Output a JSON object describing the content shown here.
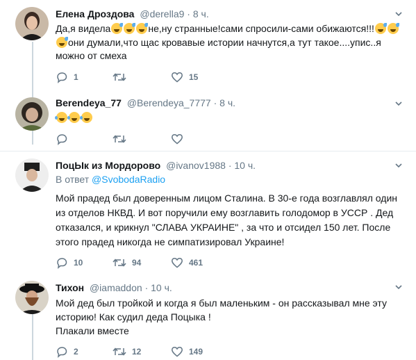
{
  "tweets": [
    {
      "name": "Елена Дроздова",
      "handle": "@derella9",
      "dot": "·",
      "time": "8 ч.",
      "line1_a": "Да,я видела",
      "line1_b": "не,ну странные!сами спросили-сами обижаются!!!",
      "line2": "они думали,что щас кровавые истории начнутся,а тут такое....упис..я",
      "line3": "можно от смеха",
      "replies": "1",
      "retweets": "",
      "likes": "15"
    },
    {
      "name": "Berendeya_77",
      "handle": "@Berendeya_7777",
      "dot": "·",
      "time": "8 ч.",
      "replies": "",
      "retweets": "",
      "likes": ""
    },
    {
      "name": "ПоцЫк из Мордорово",
      "handle": "@ivanov1988",
      "dot": "·",
      "time": "10 ч.",
      "reply_prefix": "В ответ",
      "reply_to": "@SvobodaRadio",
      "line1": "Мой прадед был доверенным лицом Сталина. В 30-е года возглавлял один",
      "line2": "из отделов НКВД.  И вот поручили ему возглавить голодомор в УССР .  Дед",
      "line3": "отказался,  и крикнул \"СЛАВА  УКРАИНЕ\" , за что и отсидел 150 лет.  После",
      "line4": "этого прадед никогда не симпатизировал Украине!",
      "replies": "10",
      "retweets": "94",
      "likes": "461"
    },
    {
      "name": "Тихон",
      "handle": "@iamaddon",
      "dot": "·",
      "time": "10 ч.",
      "line1": "Мой дед был тройкой и когда я был маленьким - он рассказывал мне эту",
      "line2": "историю! Как судил деда Поцыка !",
      "line3": "Плакали вместе",
      "replies": "2",
      "retweets": "12",
      "likes": "149"
    }
  ],
  "icons": {
    "reply": "reply-icon",
    "retweet": "retweet-icon",
    "like": "heart-icon",
    "caret": "chevron-down-icon",
    "emoji_sweat": "grinning-sweat-emoji",
    "emoji_joy": "tears-of-joy-emoji"
  },
  "colors": {
    "text": "#14171a",
    "muted": "#657786",
    "link": "#1da1f2",
    "separator": "#e6ecf0",
    "thread_line": "#ccd6dd"
  }
}
